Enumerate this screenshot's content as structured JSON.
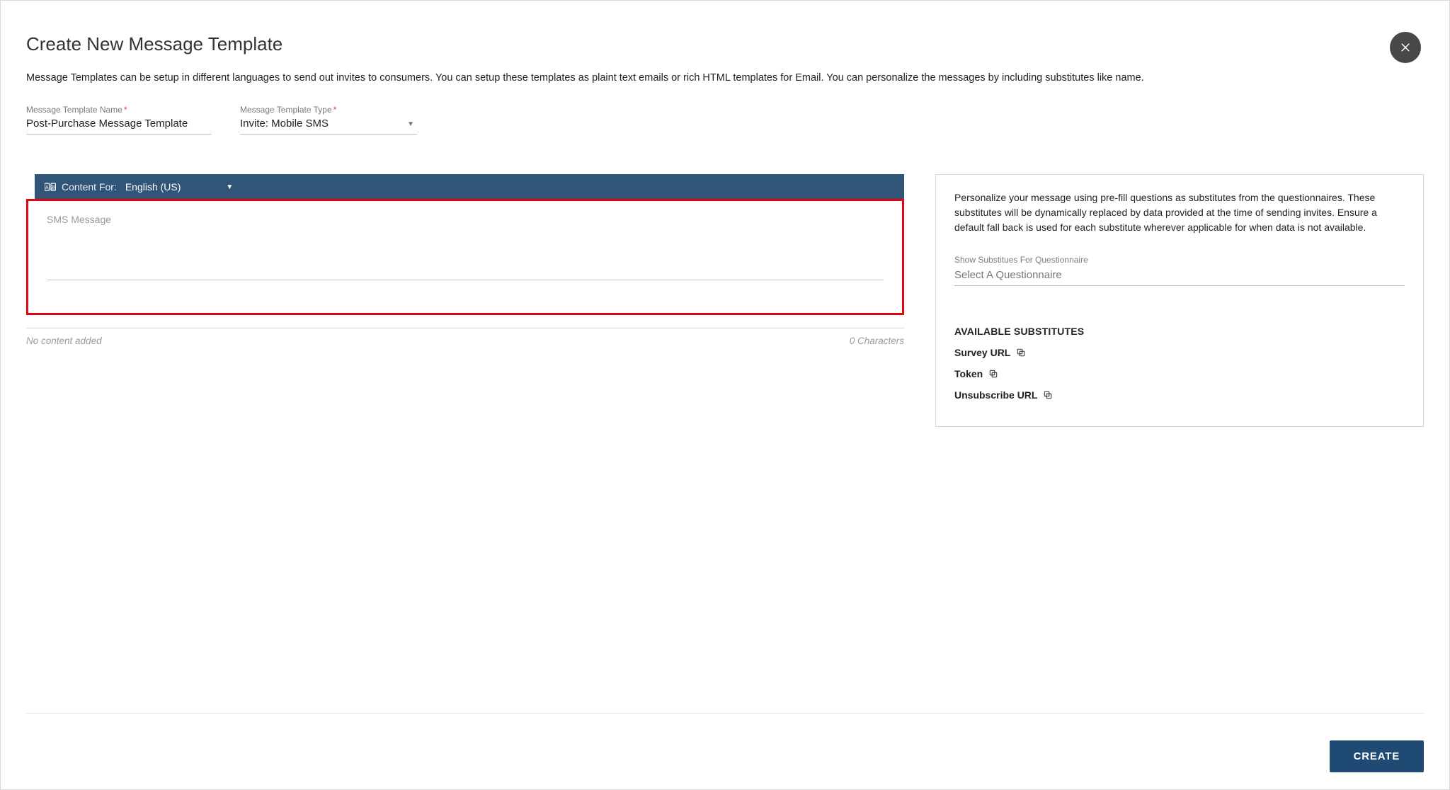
{
  "header": {
    "title": "Create New Message Template",
    "subtitle": "Message Templates can be setup in different languages to send out invites to consumers. You can setup these templates as plaint text emails or rich HTML templates for Email. You can personalize the messages by including substitutes like name."
  },
  "fields": {
    "name_label": "Message Template Name",
    "name_value": "Post-Purchase Message Template",
    "type_label": "Message Template Type",
    "type_value": "Invite: Mobile SMS"
  },
  "content_bar": {
    "label": "Content For:",
    "language": "English (US)"
  },
  "sms": {
    "placeholder": "SMS Message",
    "no_content": "No content added",
    "char_count": "0 Characters"
  },
  "right": {
    "description": "Personalize your message using pre-fill questions as substitutes from the questionnaires. These substitutes will be dynamically replaced by data provided at the time of sending invites. Ensure a default fall back is used for each substitute wherever applicable for when data is not available.",
    "show_label": "Show Substitues For Questionnaire",
    "select_placeholder": "Select A Questionnaire",
    "available_heading": "AVAILABLE SUBSTITUTES",
    "substitutes": {
      "s1": "Survey URL",
      "s2": "Token",
      "s3": "Unsubscribe URL"
    }
  },
  "footer": {
    "create": "CREATE"
  }
}
